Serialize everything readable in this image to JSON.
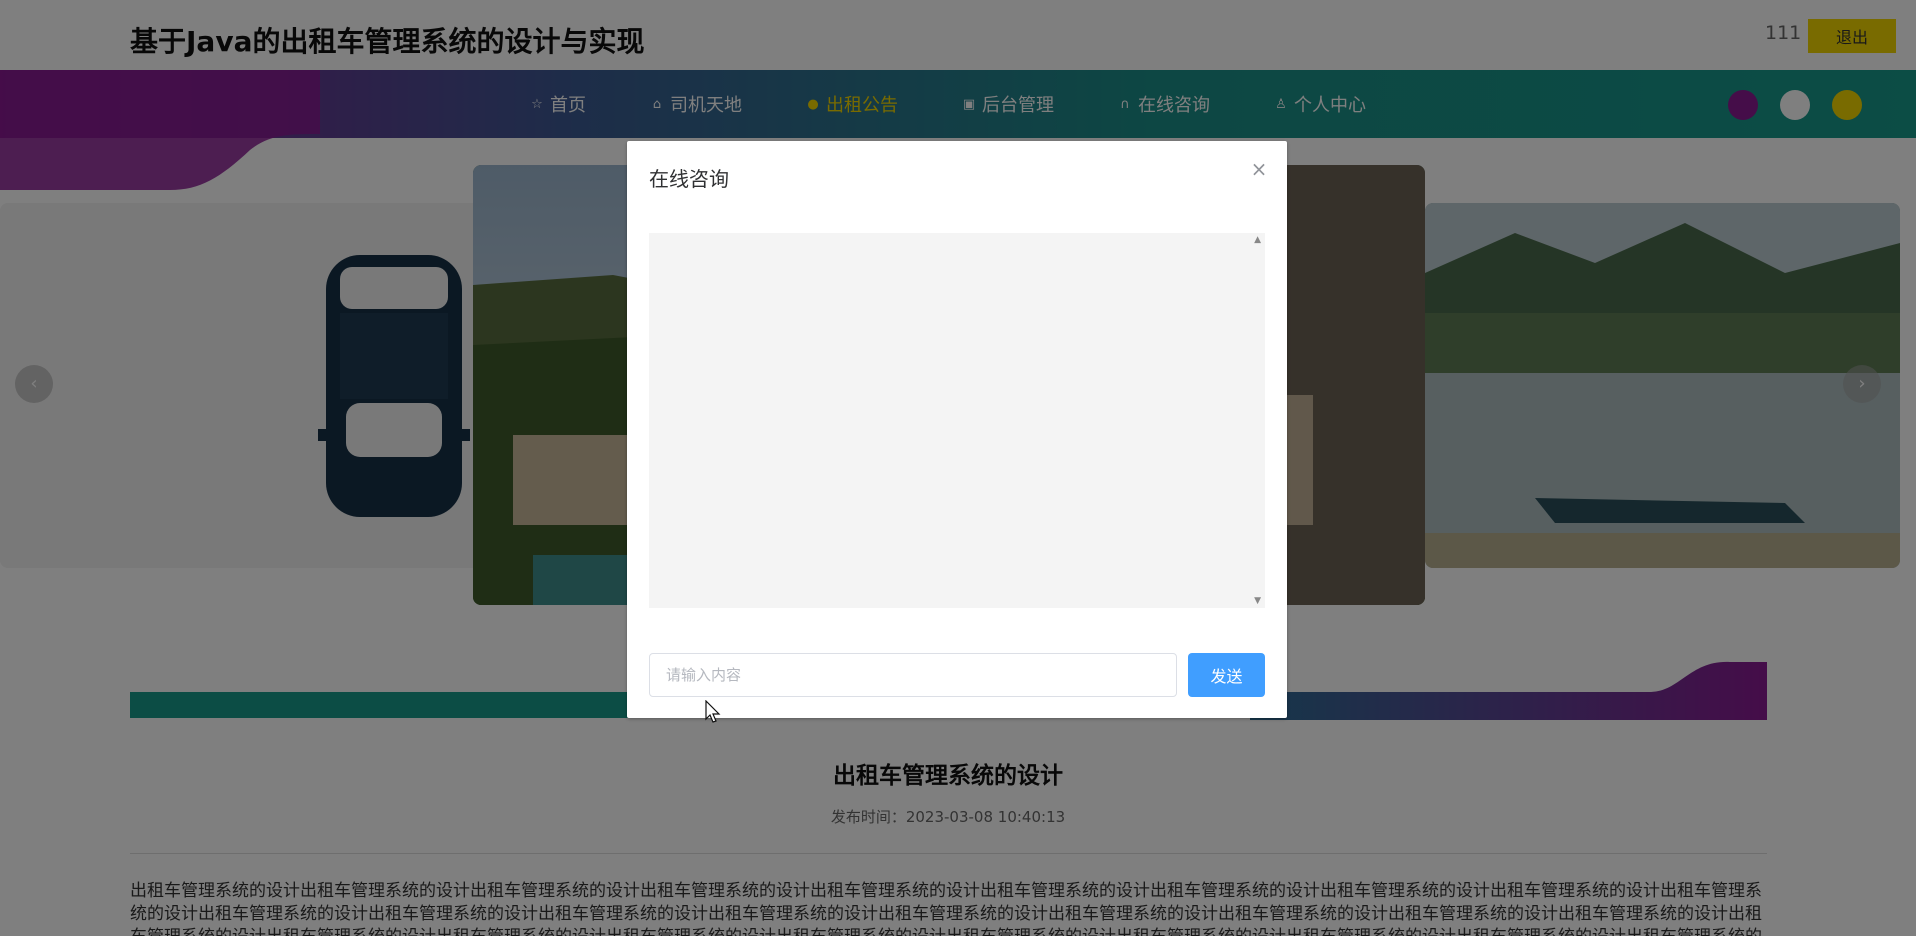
{
  "header": {
    "site_title": "基于Java的出租车管理系统的设计与实现",
    "username": "111",
    "logout_label": "退出"
  },
  "nav": {
    "items": [
      {
        "label": "首页",
        "icon": "star-icon",
        "active": false
      },
      {
        "label": "司机天地",
        "icon": "briefcase-icon",
        "active": false
      },
      {
        "label": "出租公告",
        "icon": "bell-icon",
        "active": true
      },
      {
        "label": "后台管理",
        "icon": "inbox-icon",
        "active": false
      },
      {
        "label": "在线咨询",
        "icon": "headset-icon",
        "active": false
      },
      {
        "label": "个人中心",
        "icon": "user-icon",
        "active": false
      }
    ],
    "theme_colors": [
      "#8a1a92",
      "#ffffff",
      "#f2d600"
    ],
    "active_color": "#f2d600"
  },
  "carousel": {
    "prev_label": "‹",
    "next_label": "›"
  },
  "article": {
    "title": "出租车管理系统的设计",
    "publish_line": "发布时间：2023-03-08 10:40:13",
    "body": "出租车管理系统的设计出租车管理系统的设计出租车管理系统的设计出租车管理系统的设计出租车管理系统的设计出租车管理系统的设计出租车管理系统的设计出租车管理系统的设计出租车管理系统的设计出租车管理系统的设计出租车管理系统的设计出租车管理系统的设计出租车管理系统的设计出租车管理系统的设计出租车管理系统的设计出租车管理系统的设计出租车管理系统的设计出租车管理系统的设计出租车管理系统的设计出租车管理系统的设计出租车管理系统的设计出租车管理系统的设计出租车管理系统的设计出租车管理系统的设计出租车管理系统的设计出租车管理系统的设计出租车管理系统的设计出租车管理系统的设计出租车管理系统的设计"
  },
  "dialog": {
    "title": "在线咨询",
    "close_glyph": "×",
    "input_placeholder": "请输入内容",
    "input_value": "",
    "send_label": "发送"
  },
  "colors": {
    "brand_purple": "#8a1a92",
    "brand_teal": "#199a8b",
    "accent_yellow": "#f2d600",
    "primary_blue": "#409eff"
  }
}
